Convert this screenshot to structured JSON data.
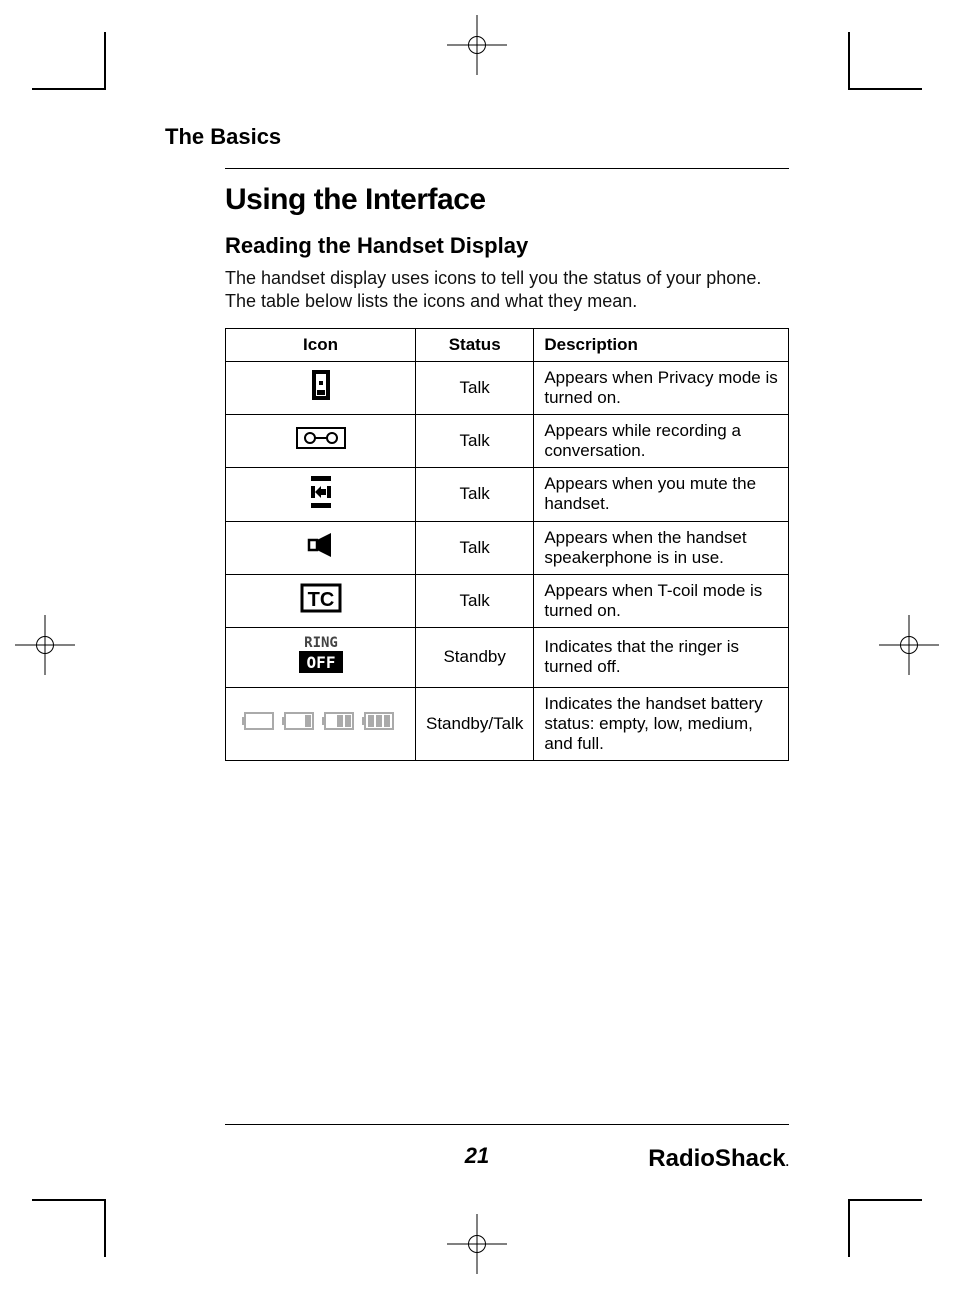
{
  "section_header": "The Basics",
  "main_heading": "Using the Interface",
  "sub_heading": "Reading the Handset Display",
  "intro_text": "The handset display uses icons to tell you the status of your phone. The table below lists the icons and what they mean.",
  "table": {
    "headers": {
      "icon": "Icon",
      "status": "Status",
      "description": "Description"
    },
    "rows": [
      {
        "icon_name": "privacy-icon",
        "status": "Talk",
        "description": "Appears when Privacy mode is turned on."
      },
      {
        "icon_name": "recording-icon",
        "status": "Talk",
        "description": "Appears while recording a conversation."
      },
      {
        "icon_name": "mute-icon",
        "status": "Talk",
        "description": "Appears when you mute the handset."
      },
      {
        "icon_name": "speaker-icon",
        "status": "Talk",
        "description": "Appears when the handset speakerphone is in use."
      },
      {
        "icon_name": "tcoil-icon",
        "status": "Talk",
        "description": "Appears when T-coil mode is turned on."
      },
      {
        "icon_name": "ring-off-icon",
        "status": "Standby",
        "description": "Indicates that the ringer is turned off."
      },
      {
        "icon_name": "battery-icon",
        "status": "Standby/Talk",
        "description": "Indicates the handset battery status: empty, low, medium, and full."
      }
    ]
  },
  "page_number": "21",
  "brand": "RadioShack"
}
